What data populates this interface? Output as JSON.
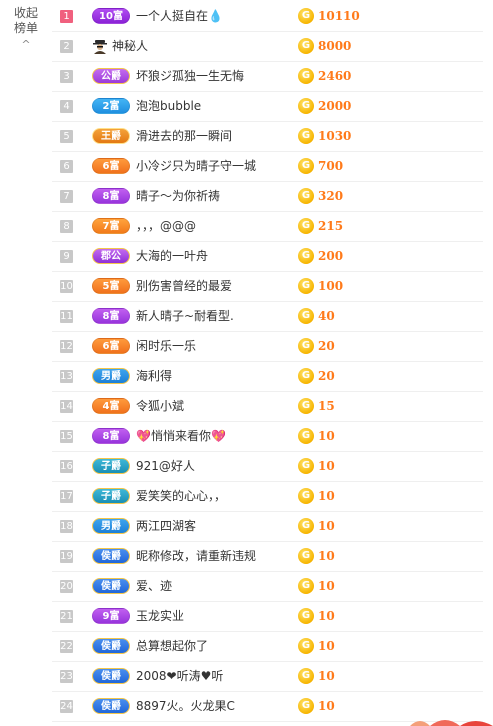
{
  "collapse_toggle": {
    "label_line1": "收起",
    "label_line2": "榜单",
    "chevron": "^"
  },
  "coin_glyph": "G",
  "rows": [
    {
      "rank": "1",
      "badge": "10富",
      "badge_style": "b-fu10",
      "name": "一个人挺自在💧",
      "amount": "10110"
    },
    {
      "rank": "2",
      "badge": "",
      "badge_style": "",
      "name": "神秘人",
      "amount": "8000",
      "mystery": true
    },
    {
      "rank": "3",
      "badge": "公爵",
      "badge_style": "b-gong",
      "name": "坏狼ジ孤独一生无悔",
      "amount": "2460"
    },
    {
      "rank": "4",
      "badge": "2富",
      "badge_style": "b-fu2",
      "name": "泡泡bubble",
      "amount": "2000"
    },
    {
      "rank": "5",
      "badge": "王爵",
      "badge_style": "b-wang",
      "name": "滑进去的那一瞬间",
      "amount": "1030"
    },
    {
      "rank": "6",
      "badge": "6富",
      "badge_style": "b-fu6",
      "name": "小冷ジ只为晴子守一城",
      "amount": "700"
    },
    {
      "rank": "7",
      "badge": "8富",
      "badge_style": "b-fu8",
      "name": "晴子～为你祈祷",
      "amount": "320"
    },
    {
      "rank": "8",
      "badge": "7富",
      "badge_style": "b-fu7",
      "name": "，，，@@@",
      "amount": "215"
    },
    {
      "rank": "9",
      "badge": "郡公",
      "badge_style": "b-jun",
      "name": "大海的一叶舟",
      "amount": "200"
    },
    {
      "rank": "10",
      "badge": "5富",
      "badge_style": "b-fu5",
      "name": "别伤害曾经的最爱",
      "amount": "100"
    },
    {
      "rank": "11",
      "badge": "8富",
      "badge_style": "b-fu8",
      "name": "新人晴子~耐看型.",
      "amount": "40"
    },
    {
      "rank": "12",
      "badge": "6富",
      "badge_style": "b-fu6",
      "name": "闲时乐一乐",
      "amount": "20"
    },
    {
      "rank": "13",
      "badge": "男爵",
      "badge_style": "b-nan",
      "name": "海利得",
      "amount": "20"
    },
    {
      "rank": "14",
      "badge": "4富",
      "badge_style": "b-fu4",
      "name": "令狐小斌",
      "amount": "15"
    },
    {
      "rank": "15",
      "badge": "8富",
      "badge_style": "b-fu8",
      "name": "💖悄悄来看你💖",
      "amount": "10"
    },
    {
      "rank": "16",
      "badge": "子爵",
      "badge_style": "b-zi",
      "name": "921@好人",
      "amount": "10"
    },
    {
      "rank": "17",
      "badge": "子爵",
      "badge_style": "b-zi",
      "name": "爱笑笑的心心，，",
      "amount": "10"
    },
    {
      "rank": "18",
      "badge": "男爵",
      "badge_style": "b-nan",
      "name": "两江四湖客",
      "amount": "10"
    },
    {
      "rank": "19",
      "badge": "侯爵",
      "badge_style": "b-hou",
      "name": "昵称修改，请重新违规",
      "amount": "10"
    },
    {
      "rank": "20",
      "badge": "侯爵",
      "badge_style": "b-hou",
      "name": "爱、迹",
      "amount": "10"
    },
    {
      "rank": "21",
      "badge": "9富",
      "badge_style": "b-fu9",
      "name": "玉龙实业",
      "amount": "10"
    },
    {
      "rank": "22",
      "badge": "侯爵",
      "badge_style": "b-hou",
      "name": "总算想起你了",
      "amount": "10"
    },
    {
      "rank": "23",
      "badge": "侯爵",
      "badge_style": "b-hou",
      "name": "2008❤听涛♥听",
      "amount": "10"
    },
    {
      "rank": "24",
      "badge": "侯爵",
      "badge_style": "b-hou",
      "name": "8897火。火龙果C",
      "amount": "10"
    }
  ]
}
